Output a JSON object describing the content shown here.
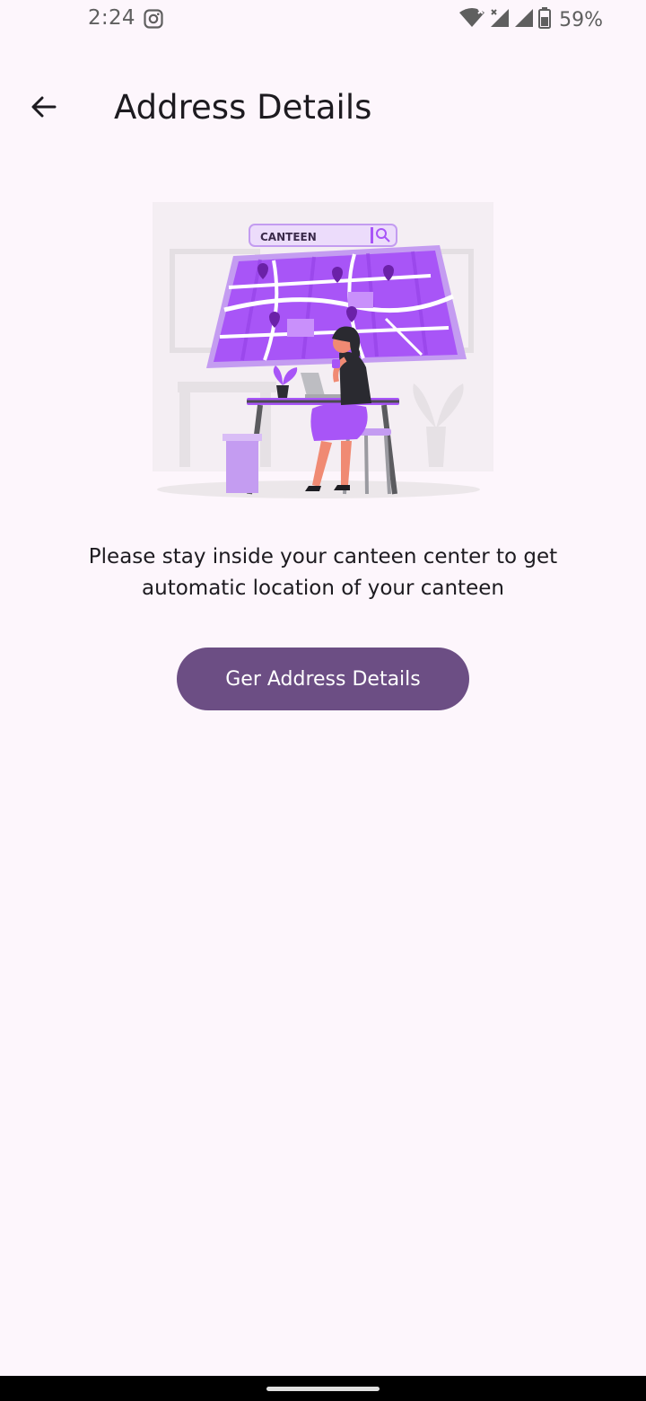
{
  "status_bar": {
    "time": "2:24",
    "battery_percent": "59%",
    "icons": [
      "instagram-icon",
      "wifi-icon",
      "signal-icon",
      "signal-icon",
      "battery-icon"
    ]
  },
  "app_bar": {
    "title": "Address Details",
    "back_icon": "arrow-back-icon"
  },
  "illustration": {
    "search_label": "CANTEEN"
  },
  "main": {
    "message": "Please stay inside your canteen center to get automatic location of your canteen",
    "button_label": "Ger Address Details"
  },
  "colors": {
    "background": "#fdf6fc",
    "primary_button": "#6c4e84",
    "illustration_accent": "#a855f7"
  }
}
